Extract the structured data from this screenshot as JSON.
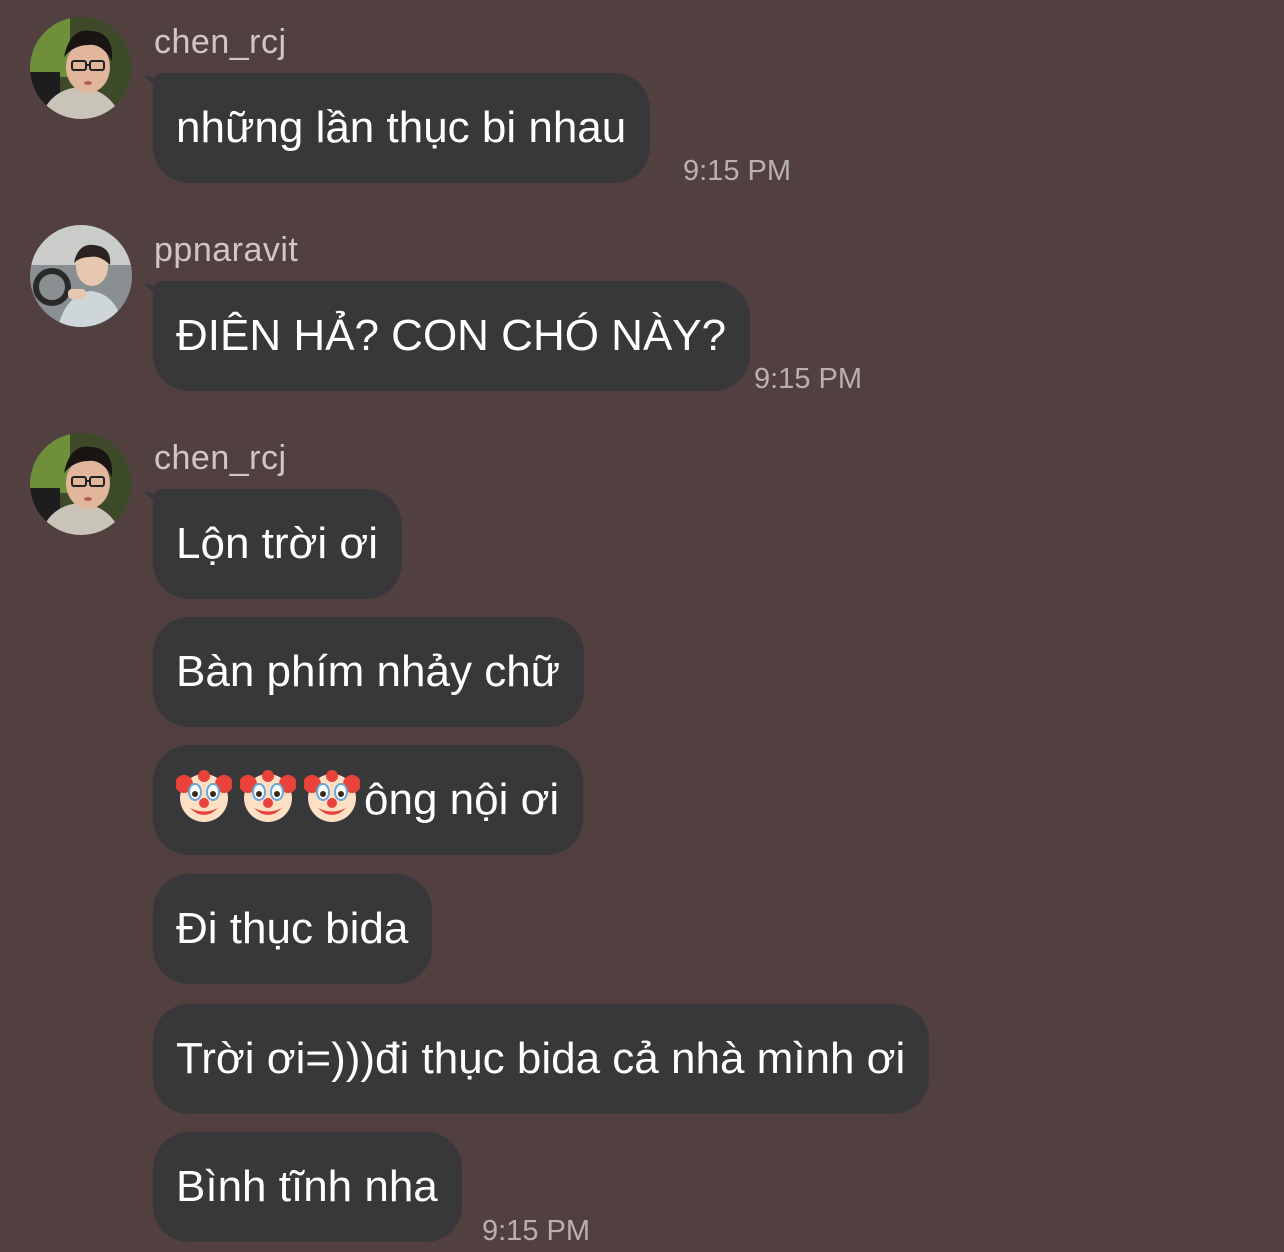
{
  "messages": [
    {
      "sender": "chen_rcj",
      "avatar": "avatar-chen",
      "bubbles": [
        {
          "text": "những lần thục bi nhau",
          "time": "9:15 PM"
        }
      ]
    },
    {
      "sender": "ppnaravit",
      "avatar": "avatar-ppnaravit",
      "bubbles": [
        {
          "text": "ĐIÊN HẢ? CON CHÓ NÀY?",
          "time": "9:15 PM"
        }
      ]
    },
    {
      "sender": "chen_rcj",
      "avatar": "avatar-chen",
      "bubbles": [
        {
          "text": "Lộn trời ơi"
        },
        {
          "text": "Bàn phím nhảy chữ"
        },
        {
          "emojis": [
            "clown-face-emoji",
            "clown-face-emoji",
            "clown-face-emoji"
          ],
          "text": "ông nội ơi"
        },
        {
          "text": "Đi thục bida"
        },
        {
          "text": "Trời ơi=)))đi thục bida cả nhà mình ơi"
        },
        {
          "text": "Bình tĩnh nha",
          "time": "9:15 PM"
        }
      ]
    }
  ],
  "colors": {
    "background": "#524041",
    "bubble": "#38373a",
    "text": "#ffffff",
    "sender": "#cfc6c6",
    "time": "#b9b0b0"
  }
}
